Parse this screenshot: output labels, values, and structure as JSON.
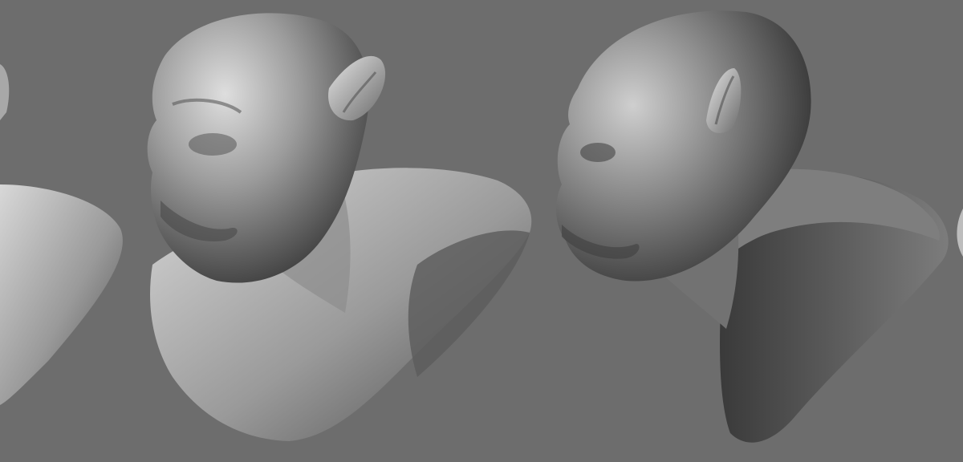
{
  "colors": {
    "background": "#6d6d6d",
    "clay_light": "#d6d6d6",
    "clay_mid": "#8e8e8e",
    "clay_dark": "#3f3f3f"
  }
}
